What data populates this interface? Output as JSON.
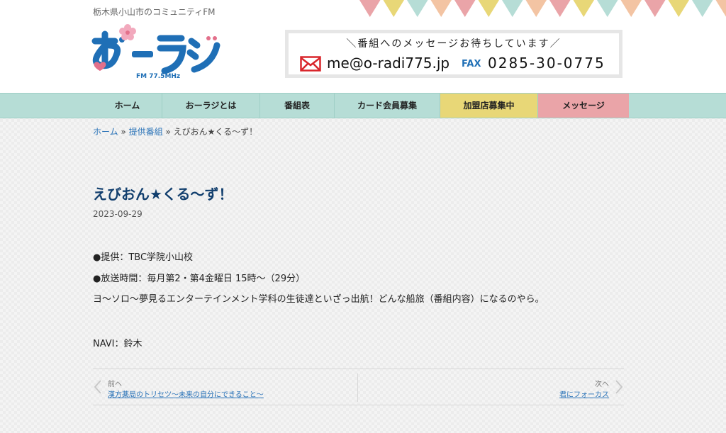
{
  "header": {
    "tagline": "栃木県小山市のコミュニティFM",
    "logo": {
      "text": "おーラジ",
      "freq": "FM 77.5MHz"
    },
    "contact": {
      "heading": "＼番組へのメッセージお待ちしています／",
      "email": "me@o-radi775.jp",
      "fax_label": "FAX",
      "fax_number": "0285-30-0775"
    },
    "bunting_colors": [
      "#eaa4a8",
      "#e8d777",
      "#b6ddd6",
      "#f3c4a3"
    ]
  },
  "nav": {
    "items": [
      {
        "label": "ホーム"
      },
      {
        "label": "おーラジとは"
      },
      {
        "label": "番組表"
      },
      {
        "label": "カード会員募集"
      },
      {
        "label": "加盟店募集中"
      },
      {
        "label": "メッセージ"
      }
    ]
  },
  "breadcrumb": {
    "home": "ホーム",
    "sep1": " » ",
    "category": "提供番組",
    "sep2": " » ",
    "current": "えびおん★くる〜ず！"
  },
  "post": {
    "title": "えびおん★くる〜ず！",
    "date": "2023-09-29",
    "lines": [
      "●提供：TBC学院小山校",
      "●放送時間：毎月第2・第4金曜日 15時〜（29分）",
      "ヨ〜ソロ〜夢見るエンターテインメント学科の生徒達といざっ出航！どんな船旅（番組内容）になるのやら。",
      "NAVI：鈴木"
    ]
  },
  "post_nav": {
    "prev_label": "前へ",
    "prev_title": "漢方薬局のトリセツ〜未来の自分にできること〜",
    "next_label": "次へ",
    "next_title": "君にフォーカス"
  },
  "colors": {
    "nav_bg": "#b6ddd6",
    "nav_yellow": "#e8d777",
    "nav_pink": "#eaa4a8",
    "title": "#123f6e",
    "link": "#2a73b8",
    "logo_blue": "#1f6fb6"
  }
}
